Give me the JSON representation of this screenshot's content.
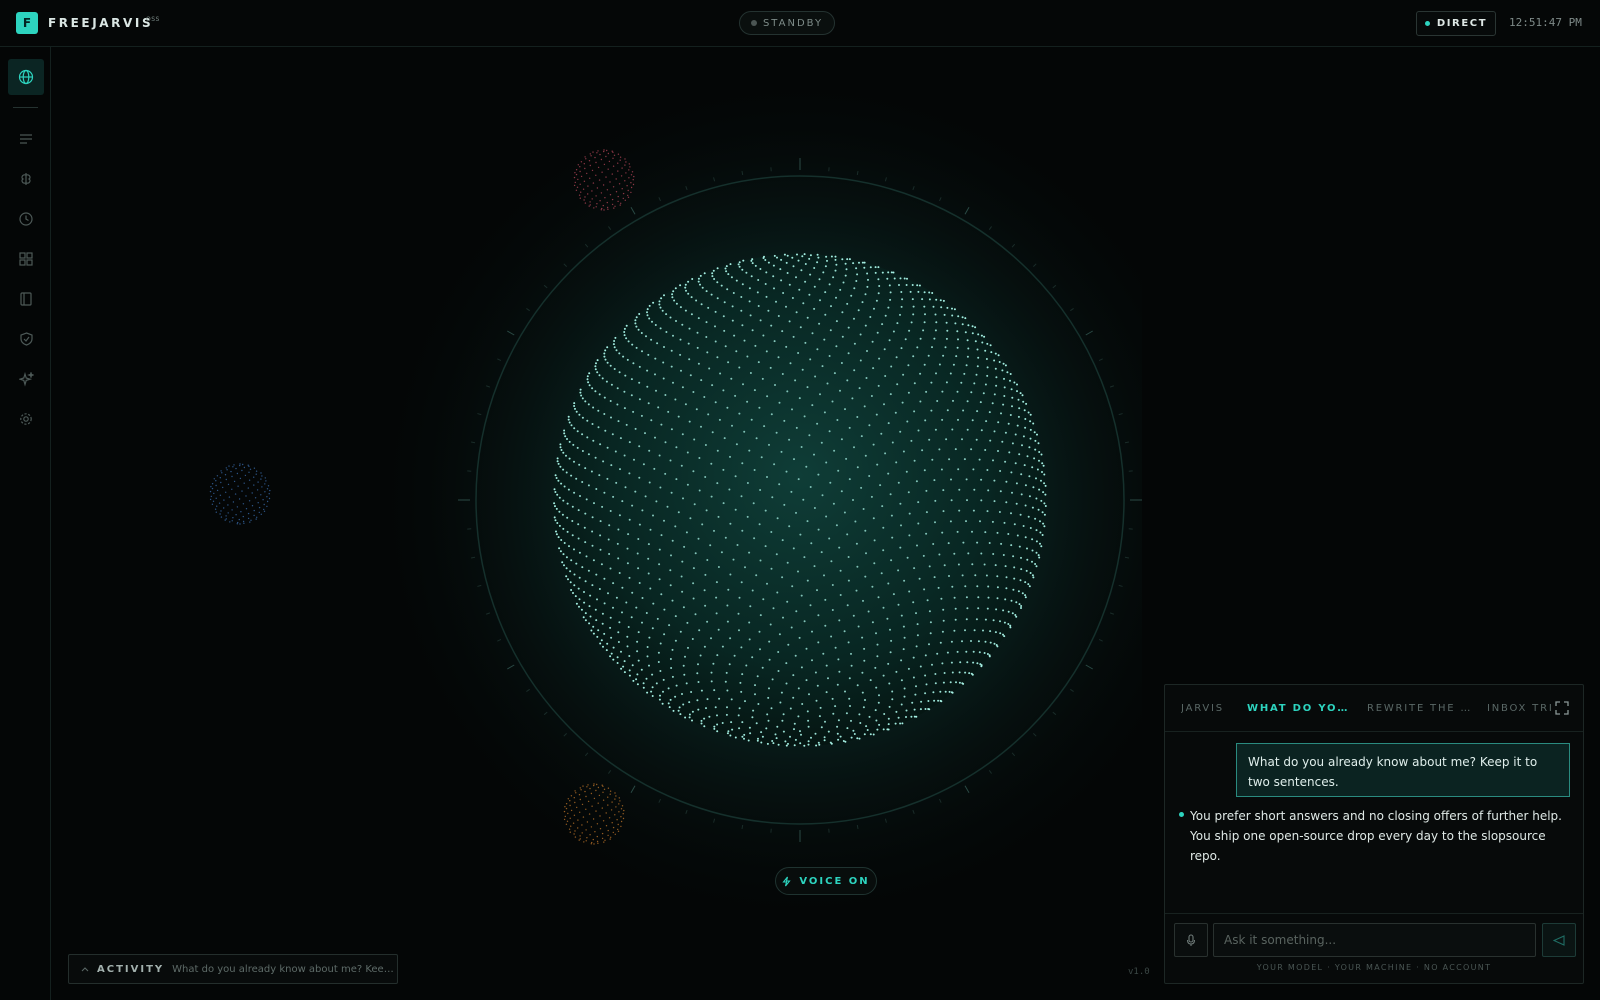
{
  "header": {
    "logo_letter": "F",
    "brand": "FREEJARVIS",
    "brand_sup": "OSS",
    "status": "STANDBY",
    "mode": "DIRECT",
    "time": "12:51:47 PM"
  },
  "sidebar": {
    "items": [
      {
        "name": "globe-icon",
        "active": true
      },
      {
        "name": "list-icon",
        "active": false
      },
      {
        "name": "brain-icon",
        "active": false
      },
      {
        "name": "clock-icon",
        "active": false
      },
      {
        "name": "grid-icon",
        "active": false
      },
      {
        "name": "book-icon",
        "active": false
      },
      {
        "name": "shield-icon",
        "active": false
      },
      {
        "name": "sparkle-icon",
        "active": false
      },
      {
        "name": "gear-icon",
        "active": false
      }
    ]
  },
  "orb": {
    "accent": "#2dd4bf",
    "mini_orbs": [
      {
        "color": "#b8485b"
      },
      {
        "color": "#3b6fb0"
      },
      {
        "color": "#c47a2c"
      }
    ]
  },
  "voice": {
    "label": "VOICE ON"
  },
  "activity": {
    "label": "ACTIVITY",
    "text": "What do you already know about me? Keep it to two sentences."
  },
  "version": "v1.0",
  "chat": {
    "tabs": [
      "JARVIS",
      "WHAT DO YOU ALREADY KNOW ABOUT ME",
      "REWRITE THE PARAGRAPH",
      "INBOX TRIAGE"
    ],
    "active_tab": 1,
    "messages": [
      {
        "role": "user",
        "text": "What do you already know about me? Keep it to two sentences."
      },
      {
        "role": "assistant",
        "text": "You prefer short answers and no closing offers of further help. You ship one open-source drop every day to the slopsource repo."
      }
    ],
    "input_placeholder": "Ask it something...",
    "footer": "YOUR MODEL · YOUR MACHINE · NO ACCOUNT"
  }
}
